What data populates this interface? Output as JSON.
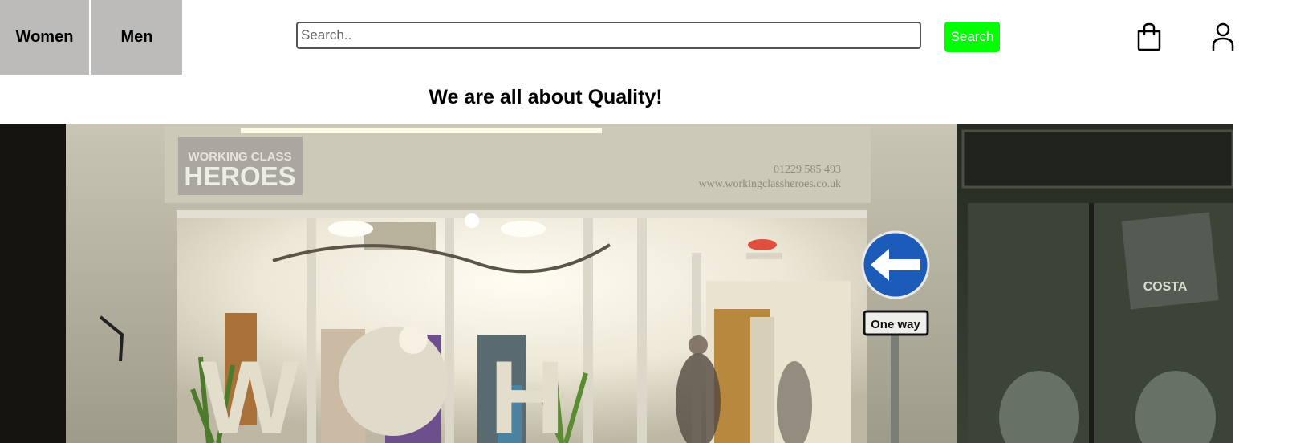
{
  "nav": {
    "items": [
      {
        "label": "Women"
      },
      {
        "label": "Men"
      }
    ]
  },
  "search": {
    "placeholder": "Search..",
    "value": "",
    "button_label": "Search"
  },
  "icons": {
    "cart": "shopping-bag-icon",
    "account": "user-icon"
  },
  "tagline": "We are all about Quality!",
  "hero": {
    "shop_sign": "WORKING CLASS HEROES",
    "phone": "01229 585 493",
    "website": "www.workingclassheroes.co.uk",
    "road_sign": "One way",
    "neighbor_sign": "COSTA",
    "window_letters": "W H"
  },
  "colors": {
    "nav_bg": "#bdbbb9",
    "search_button": "#00ff00"
  }
}
